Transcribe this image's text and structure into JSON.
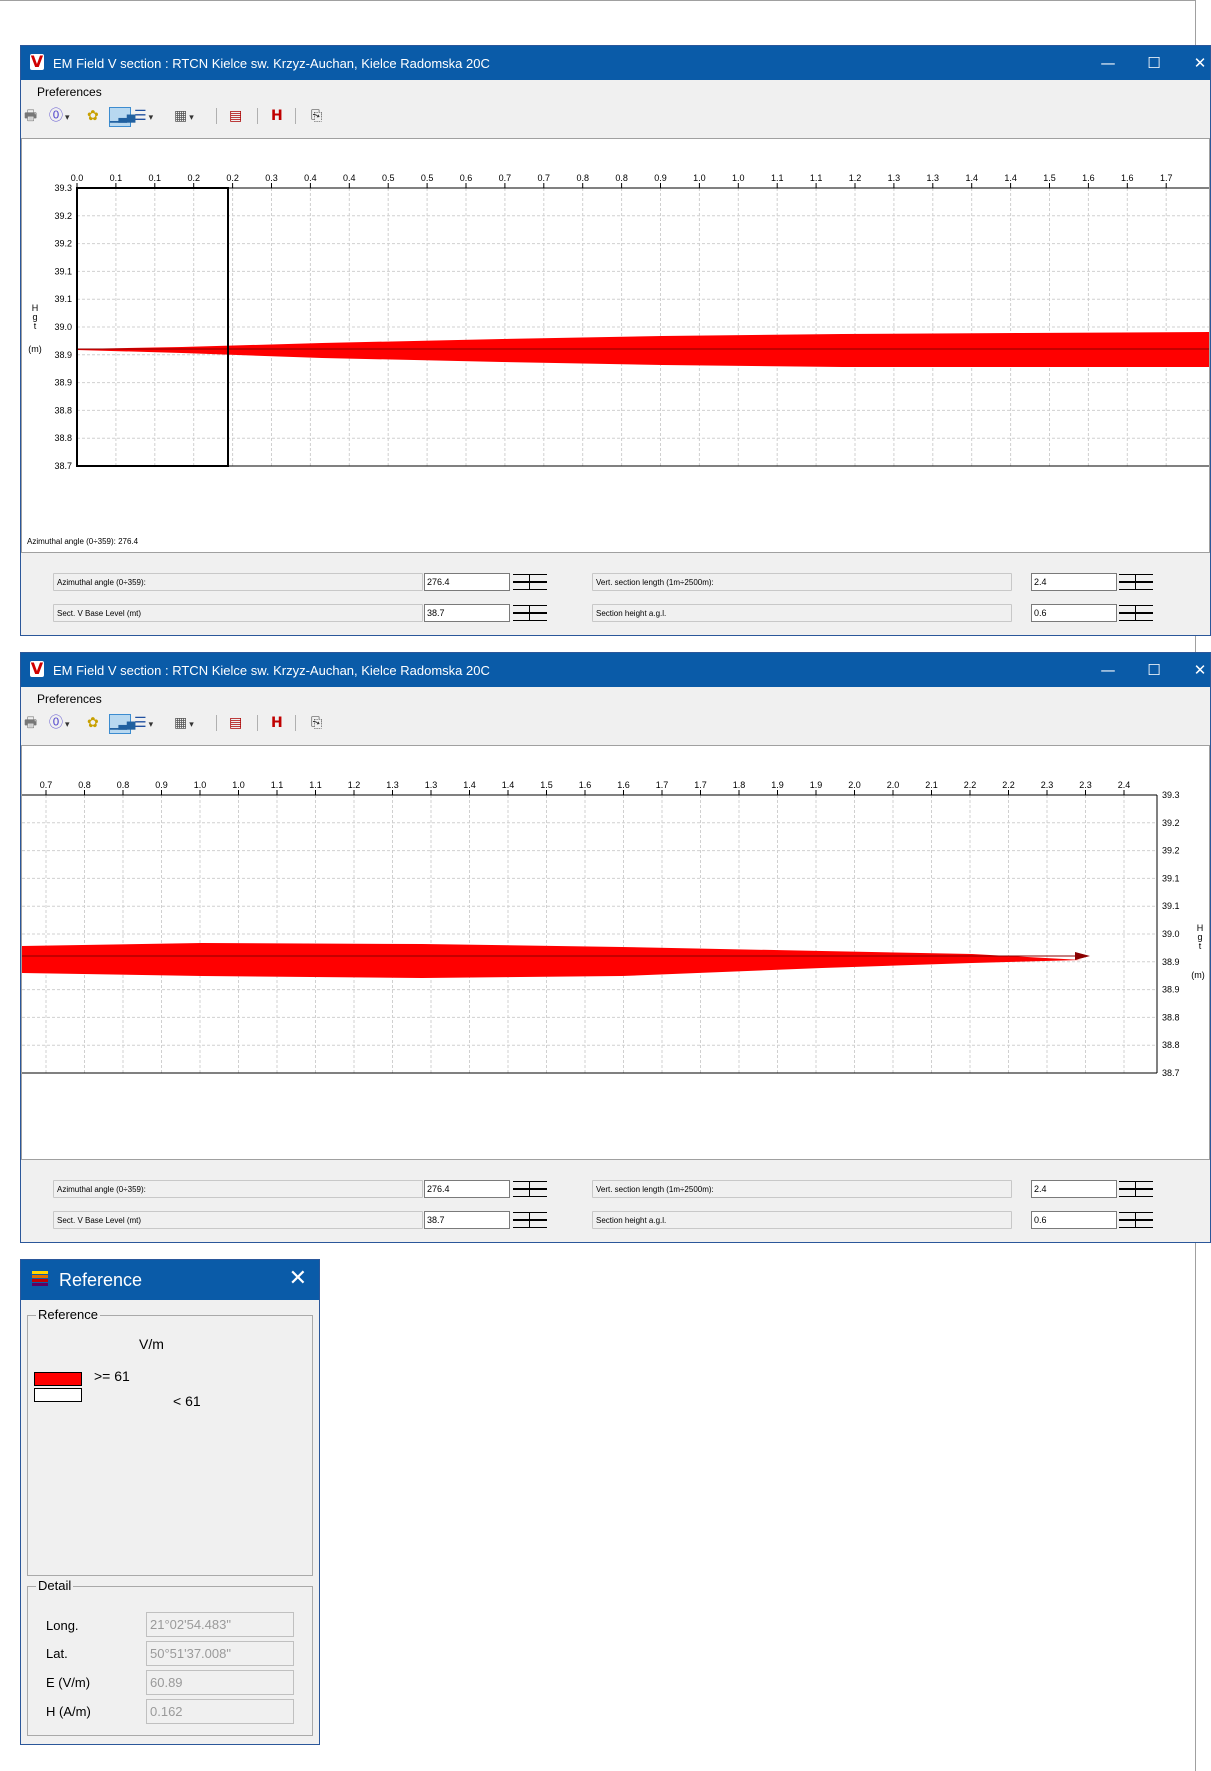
{
  "window1": {
    "title": "EM Field V section : RTCN Kielce sw. Krzyz-Auchan, Kielce Radomska 20C",
    "menu": "Preferences",
    "x_ticks": [
      "0.0",
      "0.1",
      "0.1",
      "0.2",
      "0.2",
      "0.3",
      "0.4",
      "0.4",
      "0.5",
      "0.5",
      "0.6",
      "0.7",
      "0.7",
      "0.8",
      "0.8",
      "0.9",
      "1.0",
      "1.0",
      "1.1",
      "1.1",
      "1.2",
      "1.3",
      "1.3",
      "1.4",
      "1.4",
      "1.5",
      "1.6",
      "1.6",
      "1.7"
    ],
    "y_ticks": [
      "39.3",
      "39.2",
      "39.2",
      "39.1",
      "39.1",
      "39.0",
      "38.9",
      "38.9",
      "38.8",
      "38.8",
      "38.7"
    ],
    "y_axis_label": "H\ng\nt",
    "y_axis_unit": "(m)",
    "status": "Azimuthal angle (0÷359): 276.4",
    "params": {
      "azimuth_label": "Azimuthal angle (0÷359):",
      "azimuth_value": "276.4",
      "vert_length_label": "Vert. section length (1m÷2500m):",
      "vert_length_value": "2.4",
      "base_level_label": "Sect. V Base Level (mt)",
      "base_level_value": "38.7",
      "section_height_label": "Section height a.g.l.",
      "section_height_value": "0.6"
    }
  },
  "window2": {
    "title": "EM Field V section : RTCN Kielce sw. Krzyz-Auchan, Kielce Radomska 20C",
    "menu": "Preferences",
    "x_ticks": [
      "0.7",
      "0.8",
      "0.8",
      "0.9",
      "1.0",
      "1.0",
      "1.1",
      "1.1",
      "1.2",
      "1.3",
      "1.3",
      "1.4",
      "1.4",
      "1.5",
      "1.6",
      "1.6",
      "1.7",
      "1.7",
      "1.8",
      "1.9",
      "1.9",
      "2.0",
      "2.0",
      "2.1",
      "2.2",
      "2.2",
      "2.3",
      "2.3",
      "2.4"
    ],
    "y_ticks": [
      "39.3",
      "39.2",
      "39.2",
      "39.1",
      "39.1",
      "39.0",
      "38.9",
      "38.9",
      "38.8",
      "38.8",
      "38.7"
    ],
    "y_axis_label": "H\ng\nt",
    "y_axis_unit": "(m)",
    "params": {
      "azimuth_label": "Azimuthal angle (0÷359):",
      "azimuth_value": "276.4",
      "vert_length_label": "Vert. section length (1m÷2500m):",
      "vert_length_value": "2.4",
      "base_level_label": "Sect. V Base Level (mt)",
      "base_level_value": "38.7",
      "section_height_label": "Section height a.g.l.",
      "section_height_value": "0.6"
    }
  },
  "reference": {
    "title": "Reference",
    "group_label": "Reference",
    "unit": "V/m",
    "legend": [
      {
        "label": ">= 61",
        "color": "#ff0000"
      },
      {
        "label": "< 61",
        "color": "#ffffff"
      }
    ],
    "detail_label": "Detail",
    "details": [
      {
        "label": "Long.",
        "value": "21°02'54.483\""
      },
      {
        "label": "Lat.",
        "value": "50°51'37.008\""
      },
      {
        "label": "E (V/m)",
        "value": "60.89"
      },
      {
        "label": "H (A/m)",
        "value": "0.162"
      }
    ]
  },
  "colors": {
    "field": "#ff0000",
    "titlebar": "#0a5ba8",
    "axis_line": "#8b0000"
  }
}
